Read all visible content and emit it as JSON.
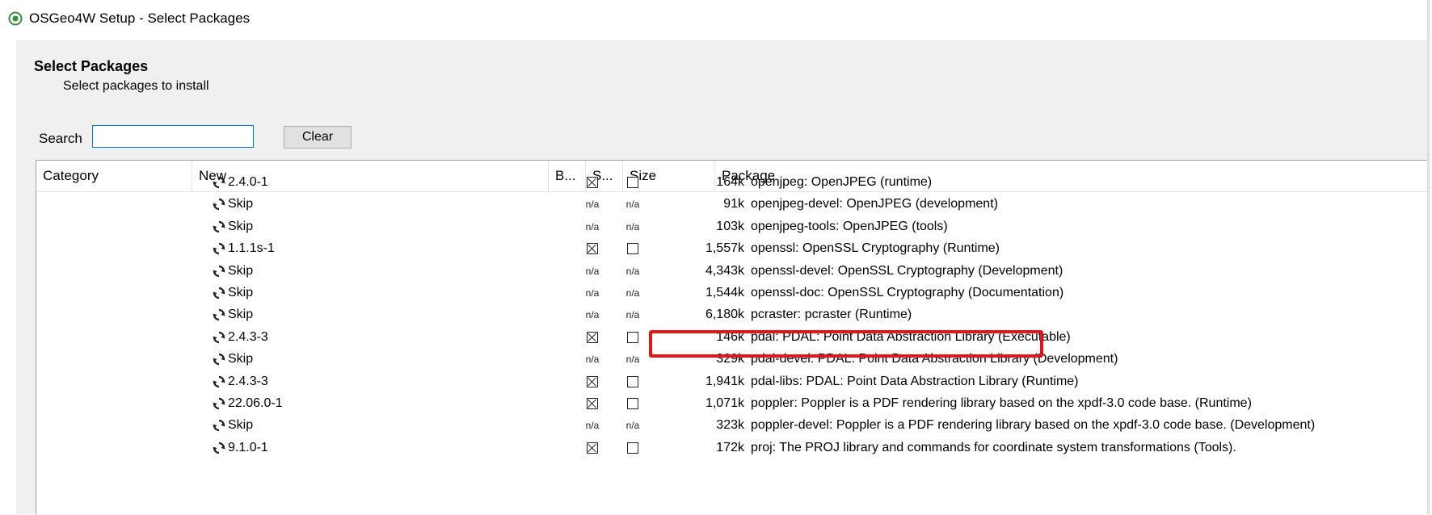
{
  "window": {
    "title": "OSGeo4W Setup - Select Packages"
  },
  "header": {
    "title": "Select Packages",
    "subtitle": "Select packages to install"
  },
  "search": {
    "label": "Search",
    "value": "",
    "clear_label": "Clear"
  },
  "columns": {
    "category": "Category",
    "new": "New",
    "binary": "B...",
    "source": "S...",
    "size": "Size",
    "package": "Package"
  },
  "rows": [
    {
      "new": "2.4.0-1",
      "bin": "checked",
      "src": "unchecked",
      "size": "164k",
      "package": "openjpeg: OpenJPEG (runtime)"
    },
    {
      "new": "Skip",
      "bin": "n/a",
      "src": "n/a",
      "size": "91k",
      "package": "openjpeg-devel: OpenJPEG (development)"
    },
    {
      "new": "Skip",
      "bin": "n/a",
      "src": "n/a",
      "size": "103k",
      "package": "openjpeg-tools: OpenJPEG (tools)"
    },
    {
      "new": "1.1.1s-1",
      "bin": "checked",
      "src": "unchecked",
      "size": "1,557k",
      "package": "openssl: OpenSSL Cryptography (Runtime)"
    },
    {
      "new": "Skip",
      "bin": "n/a",
      "src": "n/a",
      "size": "4,343k",
      "package": "openssl-devel: OpenSSL Cryptography (Development)"
    },
    {
      "new": "Skip",
      "bin": "n/a",
      "src": "n/a",
      "size": "1,544k",
      "package": "openssl-doc: OpenSSL Cryptography (Documentation)"
    },
    {
      "new": "Skip",
      "bin": "n/a",
      "src": "n/a",
      "size": "6,180k",
      "package": "pcraster: pcraster (Runtime)"
    },
    {
      "new": "2.4.3-3",
      "bin": "checked",
      "src": "unchecked",
      "size": "146k",
      "package": "pdal: PDAL: Point Data Abstraction Library (Executable)"
    },
    {
      "new": "Skip",
      "bin": "n/a",
      "src": "n/a",
      "size": "329k",
      "package": "pdal-devel: PDAL: Point Data Abstraction Library (Development)"
    },
    {
      "new": "2.4.3-3",
      "bin": "checked",
      "src": "unchecked",
      "size": "1,941k",
      "package": "pdal-libs: PDAL: Point Data Abstraction Library (Runtime)"
    },
    {
      "new": "22.06.0-1",
      "bin": "checked",
      "src": "unchecked",
      "size": "1,071k",
      "package": "poppler: Poppler is a PDF rendering library based on the xpdf-3.0 code base. (Runtime)"
    },
    {
      "new": "Skip",
      "bin": "n/a",
      "src": "n/a",
      "size": "323k",
      "package": "poppler-devel: Poppler is a PDF rendering library based on the xpdf-3.0 code base. (Development)"
    },
    {
      "new": "9.1.0-1",
      "bin": "checked",
      "src": "unchecked",
      "size": "172k",
      "package": "proj: The PROJ library and commands for coordinate system transformations (Tools)."
    }
  ],
  "icons": {
    "app": "osgeo-app-icon",
    "cycle": "cycle-icon"
  },
  "colors": {
    "highlight": "#e5141b",
    "input_border": "#0078d7"
  }
}
